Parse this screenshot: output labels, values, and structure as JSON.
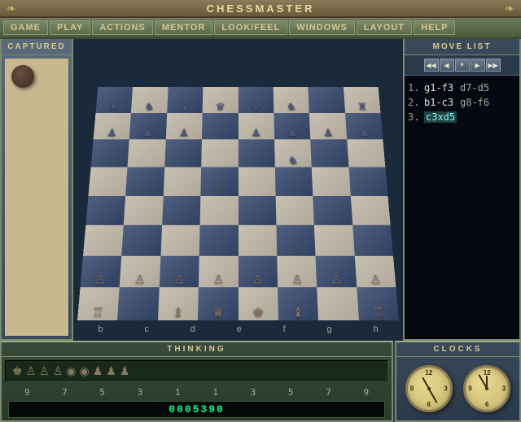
{
  "title": "CHESSMASTER",
  "menu": {
    "items": [
      {
        "label": "GAME",
        "active": false
      },
      {
        "label": "PLAY",
        "active": false
      },
      {
        "label": "ACTIONS",
        "active": false
      },
      {
        "label": "MENTOR",
        "active": false
      },
      {
        "label": "LOOK/FEEL",
        "active": false
      },
      {
        "label": "WINDOWS",
        "active": false
      },
      {
        "label": "LAYOUT",
        "active": false
      },
      {
        "label": "HELP",
        "active": false
      }
    ]
  },
  "captured_panel": {
    "title": "CAPTURED"
  },
  "move_list": {
    "title": "MOVE LIST",
    "controls": [
      "◀◀",
      "◀",
      "⏸",
      "▶",
      "▶▶"
    ],
    "moves": [
      {
        "num": "1.",
        "white": "g1-f3",
        "black": "d7-d5"
      },
      {
        "num": "2.",
        "white": "b1-c3",
        "black": "g8-f6"
      },
      {
        "num": "3.",
        "white": "c3xd5",
        "black": "",
        "highlight": true
      }
    ]
  },
  "thinking": {
    "title": "THINKING",
    "counter": "0005390",
    "eval_numbers": [
      "9",
      "7",
      "5",
      "3",
      "1",
      "1",
      "3",
      "5",
      "7",
      "9"
    ]
  },
  "clocks": {
    "title": "CLOCKS",
    "clock1": {
      "hour_angle": -30,
      "minute_angle": 150
    },
    "clock2": {
      "hour_angle": 0,
      "minute_angle": -30
    }
  },
  "board": {
    "labels_bottom": [
      "b",
      "c",
      "d",
      "e",
      "f",
      "g",
      "h"
    ]
  }
}
